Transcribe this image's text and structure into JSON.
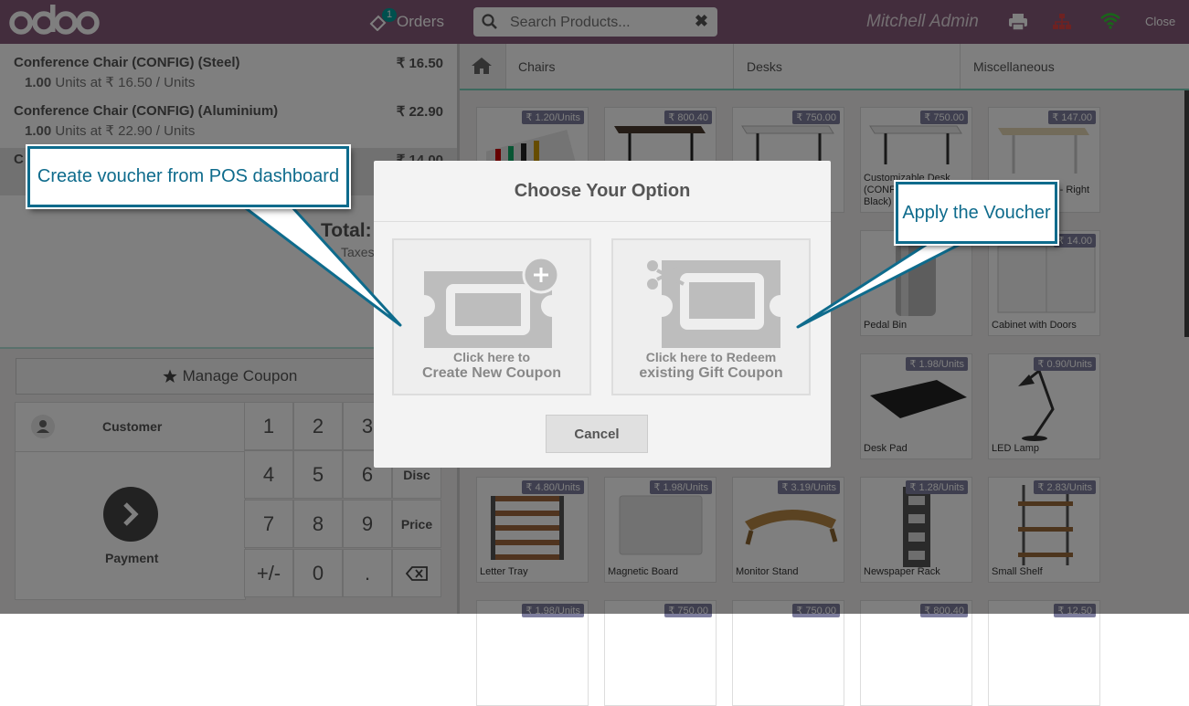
{
  "header": {
    "orders_label": "Orders",
    "orders_count": "1",
    "search_placeholder": "Search Products...",
    "user_name": "Mitchell Admin",
    "close_label": "Close"
  },
  "order": {
    "lines": [
      {
        "name": "Conference Chair (CONFIG) (Steel)",
        "price": "₹ 16.50",
        "qty": "1.00",
        "unit_info": "Units at ₹ 16.50 / Units"
      },
      {
        "name": "Conference Chair (CONFIG) (Aluminium)",
        "price": "₹ 22.90",
        "qty": "1.00",
        "unit_info": "Units at ₹ 22.90 / Units"
      }
    ],
    "partial_line": {
      "name": "C",
      "price": "₹ 14.00"
    },
    "total_label": "Total:",
    "taxes_label": "Taxes"
  },
  "actions": {
    "manage_coupon": "Manage Coupon",
    "customer": "Customer",
    "payment": "Payment"
  },
  "numpad": {
    "keys": [
      "1",
      "2",
      "3",
      "4",
      "5",
      "6",
      "7",
      "8",
      "9",
      "+/-",
      "0",
      "."
    ],
    "disc": "Disc",
    "price": "Price"
  },
  "categories": [
    "Chairs",
    "Desks",
    "Miscellaneous"
  ],
  "products": [
    {
      "price": "₹ 1.20/Units",
      "name": ""
    },
    {
      "price": "₹ 800.40",
      "name": ""
    },
    {
      "price": "₹ 750.00",
      "name": ""
    },
    {
      "price": "₹ 750.00",
      "name": "Customizable Desk (CONFIG) (Custom, Black)"
    },
    {
      "price": "₹ 147.00",
      "name": "Standing Desk - Right Sit"
    },
    {
      "price": "₹ 14.00",
      "name": "Cabinet with Doors"
    },
    {
      "price": "",
      "name": "Pedal Bin"
    },
    {
      "price": "₹ 1.98/Units",
      "name": "Desk Pad"
    },
    {
      "price": "₹ 0.90/Units",
      "name": "LED Lamp"
    },
    {
      "price": "₹ 4.80/Units",
      "name": "Letter Tray"
    },
    {
      "price": "₹ 1.98/Units",
      "name": "Magnetic Board"
    },
    {
      "price": "₹ 3.19/Units",
      "name": "Monitor Stand"
    },
    {
      "price": "₹ 1.28/Units",
      "name": "Newspaper Rack"
    },
    {
      "price": "₹ 2.83/Units",
      "name": "Small Shelf"
    },
    {
      "price": "₹ 1.98/Units",
      "name": ""
    },
    {
      "price": "₹ 750.00",
      "name": ""
    },
    {
      "price": "₹ 750.00",
      "name": ""
    },
    {
      "price": "₹ 800.40",
      "name": ""
    },
    {
      "price": "₹ 12.50",
      "name": ""
    }
  ],
  "modal": {
    "title": "Choose Your Option",
    "create_small": "Click here to",
    "create_big": "Create New Coupon",
    "redeem_small": "Click here to Redeem",
    "redeem_big": "existing Gift Coupon",
    "cancel": "Cancel"
  },
  "callouts": {
    "create": "Create voucher from POS dashboard",
    "apply": "Apply the Voucher"
  },
  "colors": {
    "topbar": "#875a7b",
    "callout_border": "#0e6b8c",
    "price_tag": "#7e7e9e"
  }
}
